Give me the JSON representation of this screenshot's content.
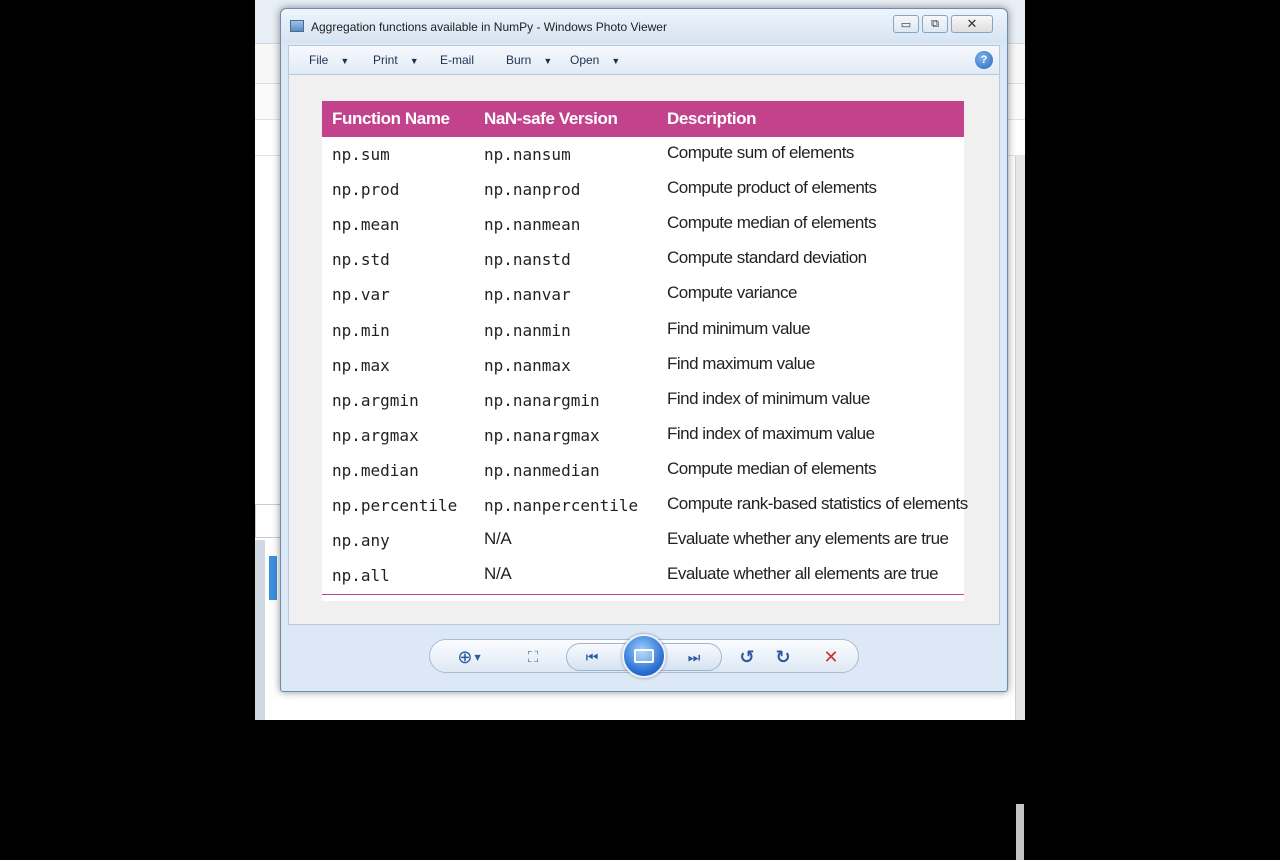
{
  "window": {
    "title": "Aggregation functions available in NumPy - Windows Photo Viewer",
    "min_glyph": "▭",
    "max_glyph": "⧉",
    "close_glyph": "✕"
  },
  "menu": {
    "items": [
      {
        "label": "File",
        "has_dropdown": true
      },
      {
        "label": "Print",
        "has_dropdown": true
      },
      {
        "label": "E-mail",
        "has_dropdown": false
      },
      {
        "label": "Burn",
        "has_dropdown": true
      },
      {
        "label": "Open",
        "has_dropdown": true
      }
    ],
    "help_glyph": "?"
  },
  "table": {
    "headers": [
      "Function Name",
      "NaN-safe Version",
      "Description"
    ],
    "rows": [
      [
        "np.sum",
        "np.nansum",
        "Compute sum of elements"
      ],
      [
        "np.prod",
        "np.nanprod",
        "Compute product of elements"
      ],
      [
        "np.mean",
        "np.nanmean",
        "Compute median of elements"
      ],
      [
        "np.std",
        "np.nanstd",
        "Compute standard deviation"
      ],
      [
        "np.var",
        "np.nanvar",
        "Compute variance"
      ],
      [
        "np.min",
        "np.nanmin",
        "Find minimum value"
      ],
      [
        "np.max",
        "np.nanmax",
        "Find maximum value"
      ],
      [
        "np.argmin",
        "np.nanargmin",
        "Find index of minimum value"
      ],
      [
        "np.argmax",
        "np.nanargmax",
        "Find index of maximum value"
      ],
      [
        "np.median",
        "np.nanmedian",
        "Compute median of elements"
      ],
      [
        "np.percentile",
        "np.nanpercentile",
        "Compute rank-based statistics of elements"
      ],
      [
        "np.any",
        "N/A",
        "Evaluate whether any elements are true"
      ],
      [
        "np.all",
        "N/A",
        "Evaluate whether all elements are true"
      ]
    ]
  },
  "controls": {
    "zoom_glyph": "⊕",
    "fit_glyph": "⛶",
    "prev_glyph": "⏮",
    "next_glyph": "⏭",
    "rotate_ccw_glyph": "↺",
    "rotate_cw_glyph": "↻",
    "delete_glyph": "✕"
  },
  "colors": {
    "header_bg": "#c2438c",
    "delete_red": "#d0312d",
    "accent_blue": "#2b5aa0"
  }
}
